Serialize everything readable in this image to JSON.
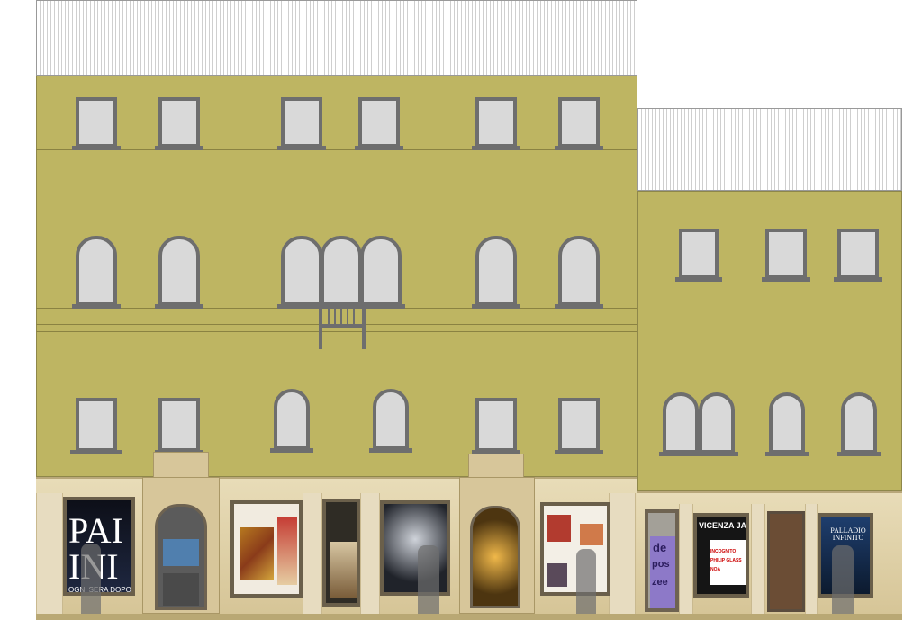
{
  "posters": {
    "paolo": {
      "big_top": "PAI",
      "big_bottom": "INI",
      "tagline": "OGNI SERA DOPO"
    },
    "jazz": {
      "title": "VICENZA JAZZ",
      "line1": "INCOGNITO",
      "line2": "PHILIP GLASS",
      "line3": "NOA"
    },
    "palladio": {
      "title": "PALLADIO INFINITO"
    },
    "deposizee": {
      "l1": "de",
      "l2": "pos",
      "l3": "zee"
    }
  },
  "colors": {
    "facade": "#beb562",
    "ground_floor": "#e3d6b0",
    "window_frame": "#6e6e6e",
    "window_glass": "#d9d9d9"
  }
}
